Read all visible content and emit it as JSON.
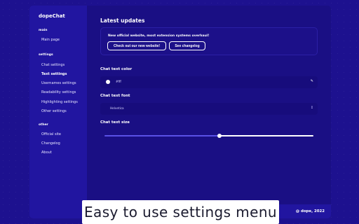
{
  "sidebar": {
    "brand": "dopeChat",
    "sections": [
      {
        "title": "main",
        "items": [
          {
            "label": "Main page"
          }
        ]
      },
      {
        "title": "settings",
        "items": [
          {
            "label": "Chat settings"
          },
          {
            "label": "Text settings",
            "active": true
          },
          {
            "label": "Usernames settings"
          },
          {
            "label": "Readability settings"
          },
          {
            "label": "Highlighting settings"
          },
          {
            "label": "Other settings"
          }
        ]
      },
      {
        "title": "other",
        "items": [
          {
            "label": "Official site"
          },
          {
            "label": "Changelog"
          },
          {
            "label": "About"
          }
        ]
      }
    ]
  },
  "main": {
    "updates": {
      "title": "Latest updates",
      "text": "New official website, most extension systems overhaul!",
      "website_button": "Check out our new website!",
      "changelog_button": "See changelog"
    },
    "text_color": {
      "label": "Chat text color",
      "value": "#fff",
      "swatch": "#ffffff",
      "picker_icon": "eyedropper-icon"
    },
    "text_font": {
      "label": "Chat text font",
      "value": "Helvetica",
      "arrow_icon": "select-arrows-icon"
    },
    "text_size": {
      "label": "Chat text size",
      "value_fraction": 0.55
    }
  },
  "footer": {
    "copyright": "@ dope, 2022"
  },
  "caption": {
    "text": "Easy to use settings menu"
  },
  "colors": {
    "background": "#1d118f",
    "panel": "#1a0f84",
    "sidebar": "#2115a0",
    "accent": "#5a51e6"
  }
}
